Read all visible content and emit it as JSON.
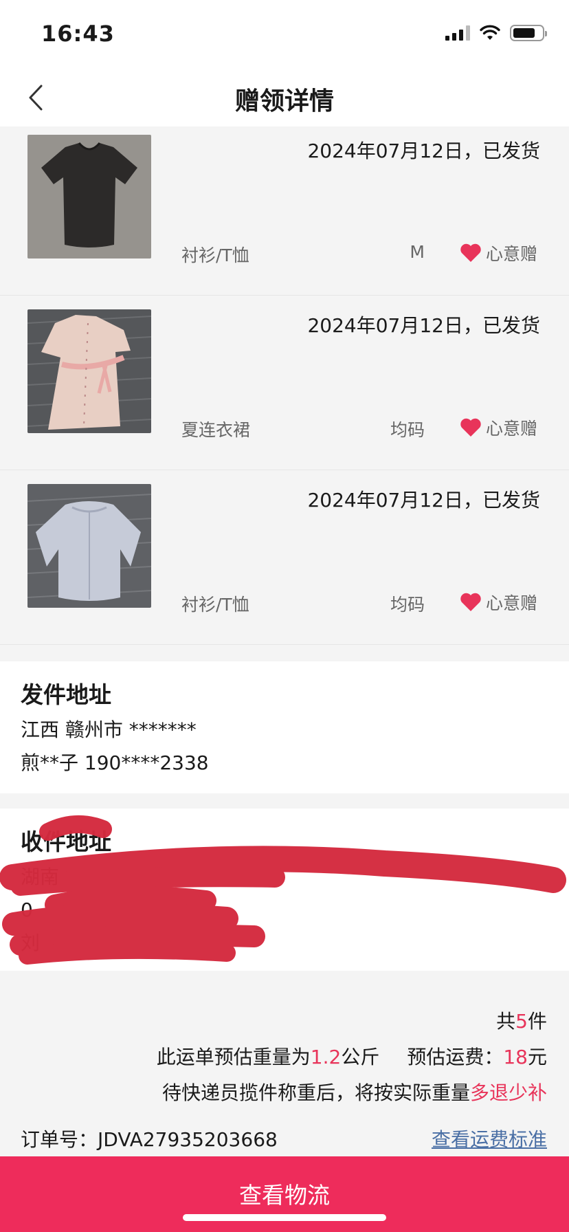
{
  "status_bar": {
    "time": "16:43"
  },
  "nav": {
    "title": "赠领详情"
  },
  "items": [
    {
      "date_status": "2024年07月12日，已发货",
      "category": "衬衫/T恤",
      "size": "M",
      "tag": "心意赠"
    },
    {
      "date_status": "2024年07月12日，已发货",
      "category": "夏连衣裙",
      "size": "均码",
      "tag": "心意赠"
    },
    {
      "date_status": "2024年07月12日，已发货",
      "category": "衬衫/T恤",
      "size": "均码",
      "tag": "心意赠"
    }
  ],
  "sender": {
    "title": "发件地址",
    "line1": "江西 赣州市 *******",
    "line2": "煎**子 190****2338"
  },
  "receiver": {
    "title": "收件地址",
    "line1": "湖南",
    "line2": "0",
    "line3": "刘"
  },
  "summary": {
    "total_prefix": "共",
    "total_count": "5",
    "total_suffix": "件",
    "weight_prefix": "此运单预估重量为",
    "weight_value": "1.2",
    "weight_unit": "公斤",
    "fee_label": "预估运费：",
    "fee_value": "18",
    "fee_unit": "元",
    "note_prefix": "待快递员揽件称重后，将按实际重量",
    "note_highlight": "多退少补",
    "order_label": "订单号：",
    "order_number": "JDVA27935203668",
    "fee_link": "查看运费标准"
  },
  "bottom_button": {
    "label": "查看物流"
  },
  "colors": {
    "accent": "#ee2c5b",
    "highlight": "#e8345a",
    "link": "#4a6fa5",
    "redaction": "#d42a3e"
  }
}
